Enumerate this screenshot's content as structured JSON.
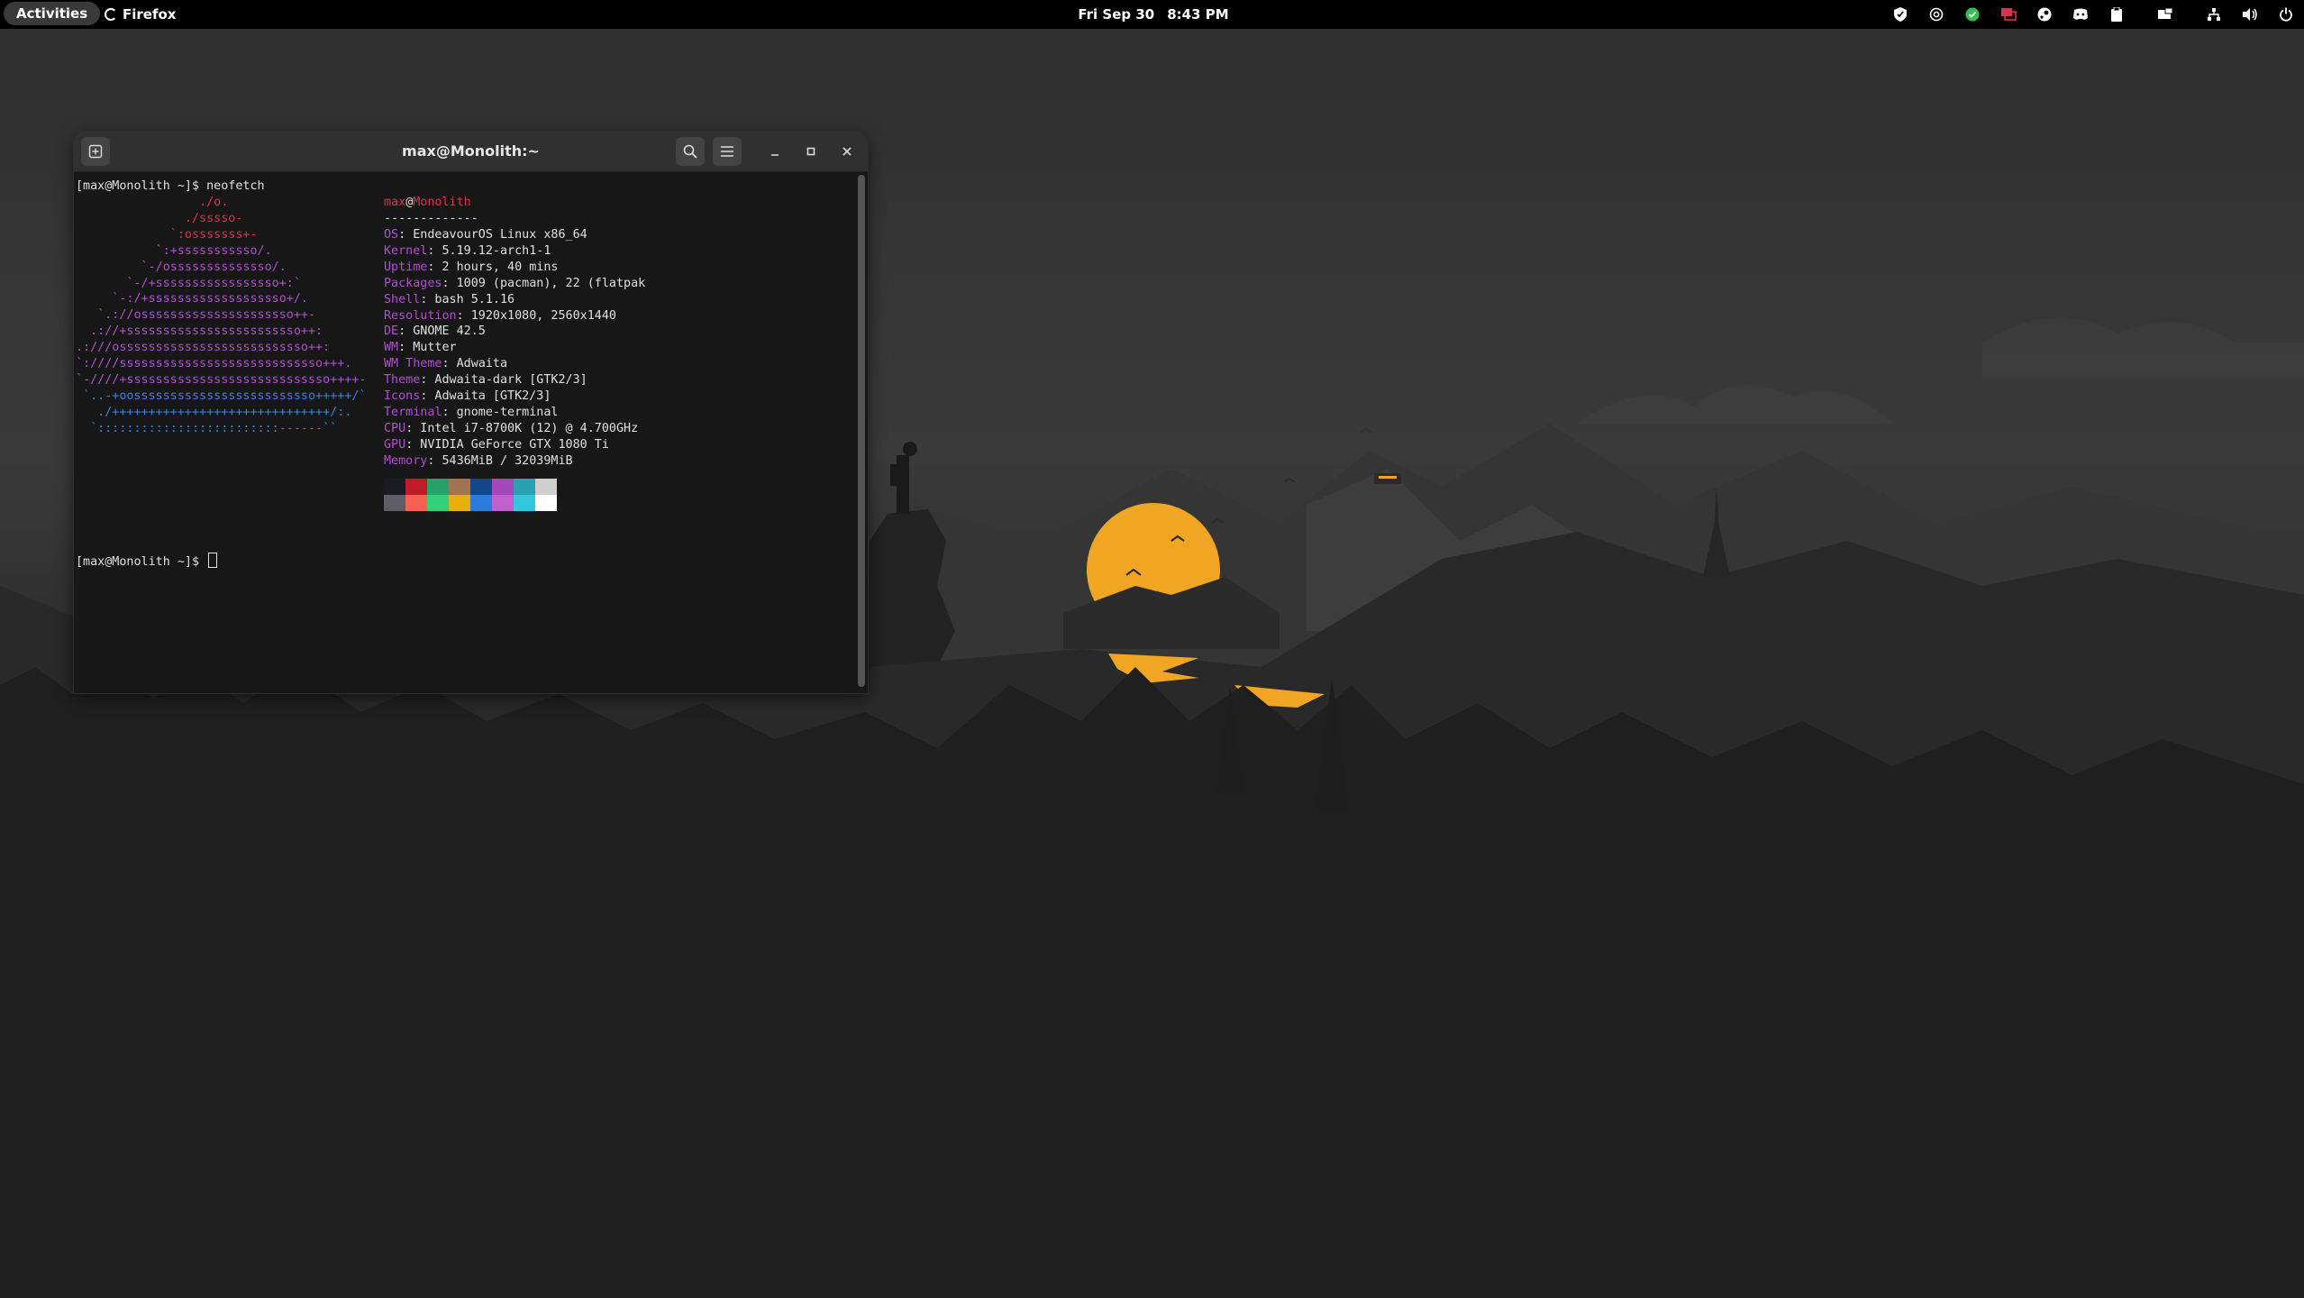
{
  "topbar": {
    "activities": "Activities",
    "app_name": "Firefox",
    "date": "Fri Sep 30",
    "time": "8:43 PM",
    "tray_icons": [
      "shield-icon",
      "at-sign-icon",
      "check-circle-icon",
      "display-icon",
      "steam-icon",
      "discord-icon",
      "clipboard-icon",
      "screen-share-icon",
      "network-icon",
      "volume-icon",
      "power-icon"
    ]
  },
  "terminal": {
    "title": "max@Monolith:~",
    "command_line": "[max@Monolith ~]$ neofetch",
    "prompt": "[max@Monolith ~]$ ",
    "logo": [
      "                 ./o.",
      "               ./sssso-",
      "             `:osssssss+-",
      "           `:+sssssssssso/.",
      "         `-/ossssssssssssso/.",
      "       `-/+sssssssssssssssso+:`",
      "     `-:/+sssssssssssssssssso+/.",
      "   `.://osssssssssssssssssssso++-",
      "  .://+ssssssssssssssssssssssso++:",
      ".:///ossssssssssssssssssssssssso++:",
      "`:////ssssssssssssssssssssssssssso+++.",
      "`-////+ssssssssssssssssssssssssssso++++-",
      " `..-+oosssssssssssssssssssssssso+++++/`",
      "   ./++++++++++++++++++++++++++++++/:.",
      "  `:::::::::::::::::::::::::------``"
    ],
    "user": "max",
    "at": "@",
    "host": "Monolith",
    "separator": "-------------",
    "info": [
      {
        "key": "OS",
        "value": ": EndeavourOS Linux x86_64"
      },
      {
        "key": "Kernel",
        "value": ": 5.19.12-arch1-1"
      },
      {
        "key": "Uptime",
        "value": ": 2 hours, 40 mins"
      },
      {
        "key": "Packages",
        "value": ": 1009 (pacman), 22 (flatpak"
      },
      {
        "key": "Shell",
        "value": ": bash 5.1.16"
      },
      {
        "key": "Resolution",
        "value": ": 1920x1080, 2560x1440"
      },
      {
        "key": "DE",
        "value": ": GNOME 42.5"
      },
      {
        "key": "WM",
        "value": ": Mutter"
      },
      {
        "key": "WM Theme",
        "value": ": Adwaita"
      },
      {
        "key": "Theme",
        "value": ": Adwaita-dark [GTK2/3]"
      },
      {
        "key": "Icons",
        "value": ": Adwaita [GTK2/3]"
      },
      {
        "key": "Terminal",
        "value": ": gnome-terminal"
      },
      {
        "key": "CPU",
        "value": ": Intel i7-8700K (12) @ 4.700GHz"
      },
      {
        "key": "GPU",
        "value": ": NVIDIA GeForce GTX 1080 Ti"
      },
      {
        "key": "Memory",
        "value": ": 5436MiB / 32039MiB"
      }
    ],
    "palette_top": [
      "#1a1a22",
      "#c01c28",
      "#26a269",
      "#a2734c",
      "#12488b",
      "#a347ba",
      "#2aa1b3",
      "#d0cfcc"
    ],
    "palette_bottom": [
      "#5e5c64",
      "#f66151",
      "#33d17a",
      "#e9ad0c",
      "#2a7bde",
      "#c061cb",
      "#33c7de",
      "#ffffff"
    ]
  },
  "colors": {
    "accent_sun": "#f0a623",
    "logo_red": "#e0304a",
    "logo_purple": "#b04fd0",
    "logo_blue": "#3a7fe0"
  }
}
